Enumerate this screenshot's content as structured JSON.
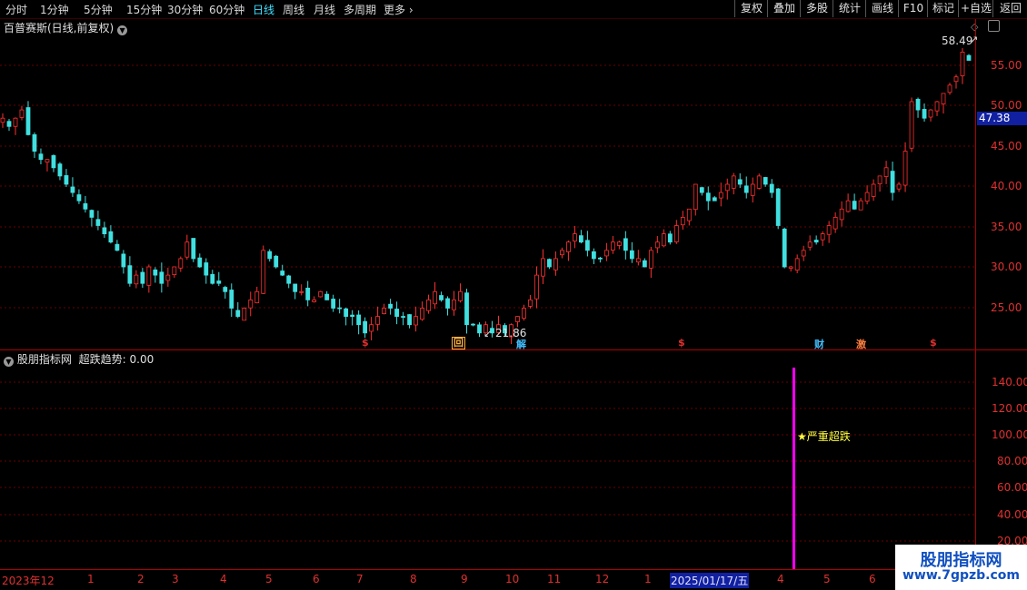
{
  "toolbar": {
    "periods": [
      "分时",
      "1分钟",
      "5分钟",
      "15分钟",
      "30分钟",
      "60分钟",
      "日线",
      "周线",
      "月线",
      "多周期",
      "更多"
    ],
    "active": "日线",
    "buttons": [
      "复权",
      "叠加",
      "多股",
      "统计",
      "画线",
      "F10",
      "标记",
      "+自选",
      "返回"
    ]
  },
  "main_panel": {
    "title": "百普赛斯(日线,前复权)",
    "high_label": "58.49",
    "low_label": "21.86",
    "current_price": "47.38",
    "markers": [
      {
        "text": "$",
        "color": "#e03030"
      },
      {
        "text": "回",
        "color": "#ffb040"
      },
      {
        "text": "解",
        "color": "#40c0ff"
      },
      {
        "text": "$",
        "color": "#e03030"
      },
      {
        "text": "财",
        "color": "#40c0ff"
      },
      {
        "text": "激",
        "color": "#ff8040"
      },
      {
        "text": "$",
        "color": "#e03030"
      }
    ]
  },
  "indicator_panel": {
    "title": "股朋指标网",
    "indicator_name": "超跌趋势:",
    "indicator_value": "0.00",
    "signal_label": "★严重超跌",
    "signal_color": "#ff00ff"
  },
  "x_axis": {
    "labels": [
      "2023年12",
      "1",
      "2",
      "3",
      "4",
      "5",
      "6",
      "7",
      "8",
      "9",
      "10",
      "11",
      "12",
      "1",
      "2025/01/17/五",
      "4",
      "5",
      "6"
    ]
  },
  "watermark": {
    "line1": "股朋指标网",
    "line2": "www.7gpzb.com"
  },
  "chart_data": {
    "type": "candlestick",
    "title": "百普赛斯(日线,前复权)",
    "price_axis": [
      55.0,
      50.0,
      45.0,
      40.0,
      35.0,
      30.0,
      25.0
    ],
    "indicator_axis": [
      140.0,
      120.0,
      100.0,
      80.0,
      60.0,
      40.0,
      20.0
    ],
    "price_ylim": [
      20,
      60
    ],
    "indicator_ylim": [
      0,
      150
    ],
    "close_series": [
      48,
      47,
      48,
      49,
      46,
      44,
      43,
      43,
      42,
      41,
      40,
      39,
      38,
      37,
      36,
      35,
      34,
      33,
      32,
      30,
      28,
      29,
      28,
      30,
      29,
      28,
      29,
      30,
      31,
      33,
      31,
      30,
      29,
      28,
      28,
      27,
      25,
      24,
      25,
      26,
      27,
      32,
      31,
      30,
      29,
      28,
      27,
      27,
      26,
      26,
      27,
      26,
      25,
      25,
      24,
      24,
      23,
      22,
      23,
      24,
      25,
      25,
      24,
      24,
      23,
      24,
      25,
      26,
      27,
      26,
      25,
      26,
      27,
      23,
      23,
      22,
      23,
      22,
      23,
      22,
      23,
      24,
      25,
      26,
      29,
      31,
      30,
      31,
      32,
      33,
      34,
      33,
      32,
      31,
      31,
      32,
      33,
      33,
      32,
      31,
      31,
      30,
      32,
      33,
      34,
      33,
      35,
      36,
      37,
      40,
      39,
      38,
      38,
      39,
      40,
      41,
      40,
      39,
      40,
      41,
      40,
      39,
      35,
      30,
      30,
      31,
      32,
      33,
      33,
      34,
      35,
      36,
      37,
      38,
      37,
      38,
      39,
      40,
      41,
      42,
      39,
      40,
      44,
      50,
      49,
      48,
      49,
      50,
      51,
      52,
      53,
      56,
      55
    ],
    "highs": [
      {
        "date": "2025",
        "value": 58.49
      }
    ],
    "lows": [
      {
        "value": 21.86
      }
    ],
    "signal": {
      "label": "★严重超跌",
      "value": 150
    }
  }
}
